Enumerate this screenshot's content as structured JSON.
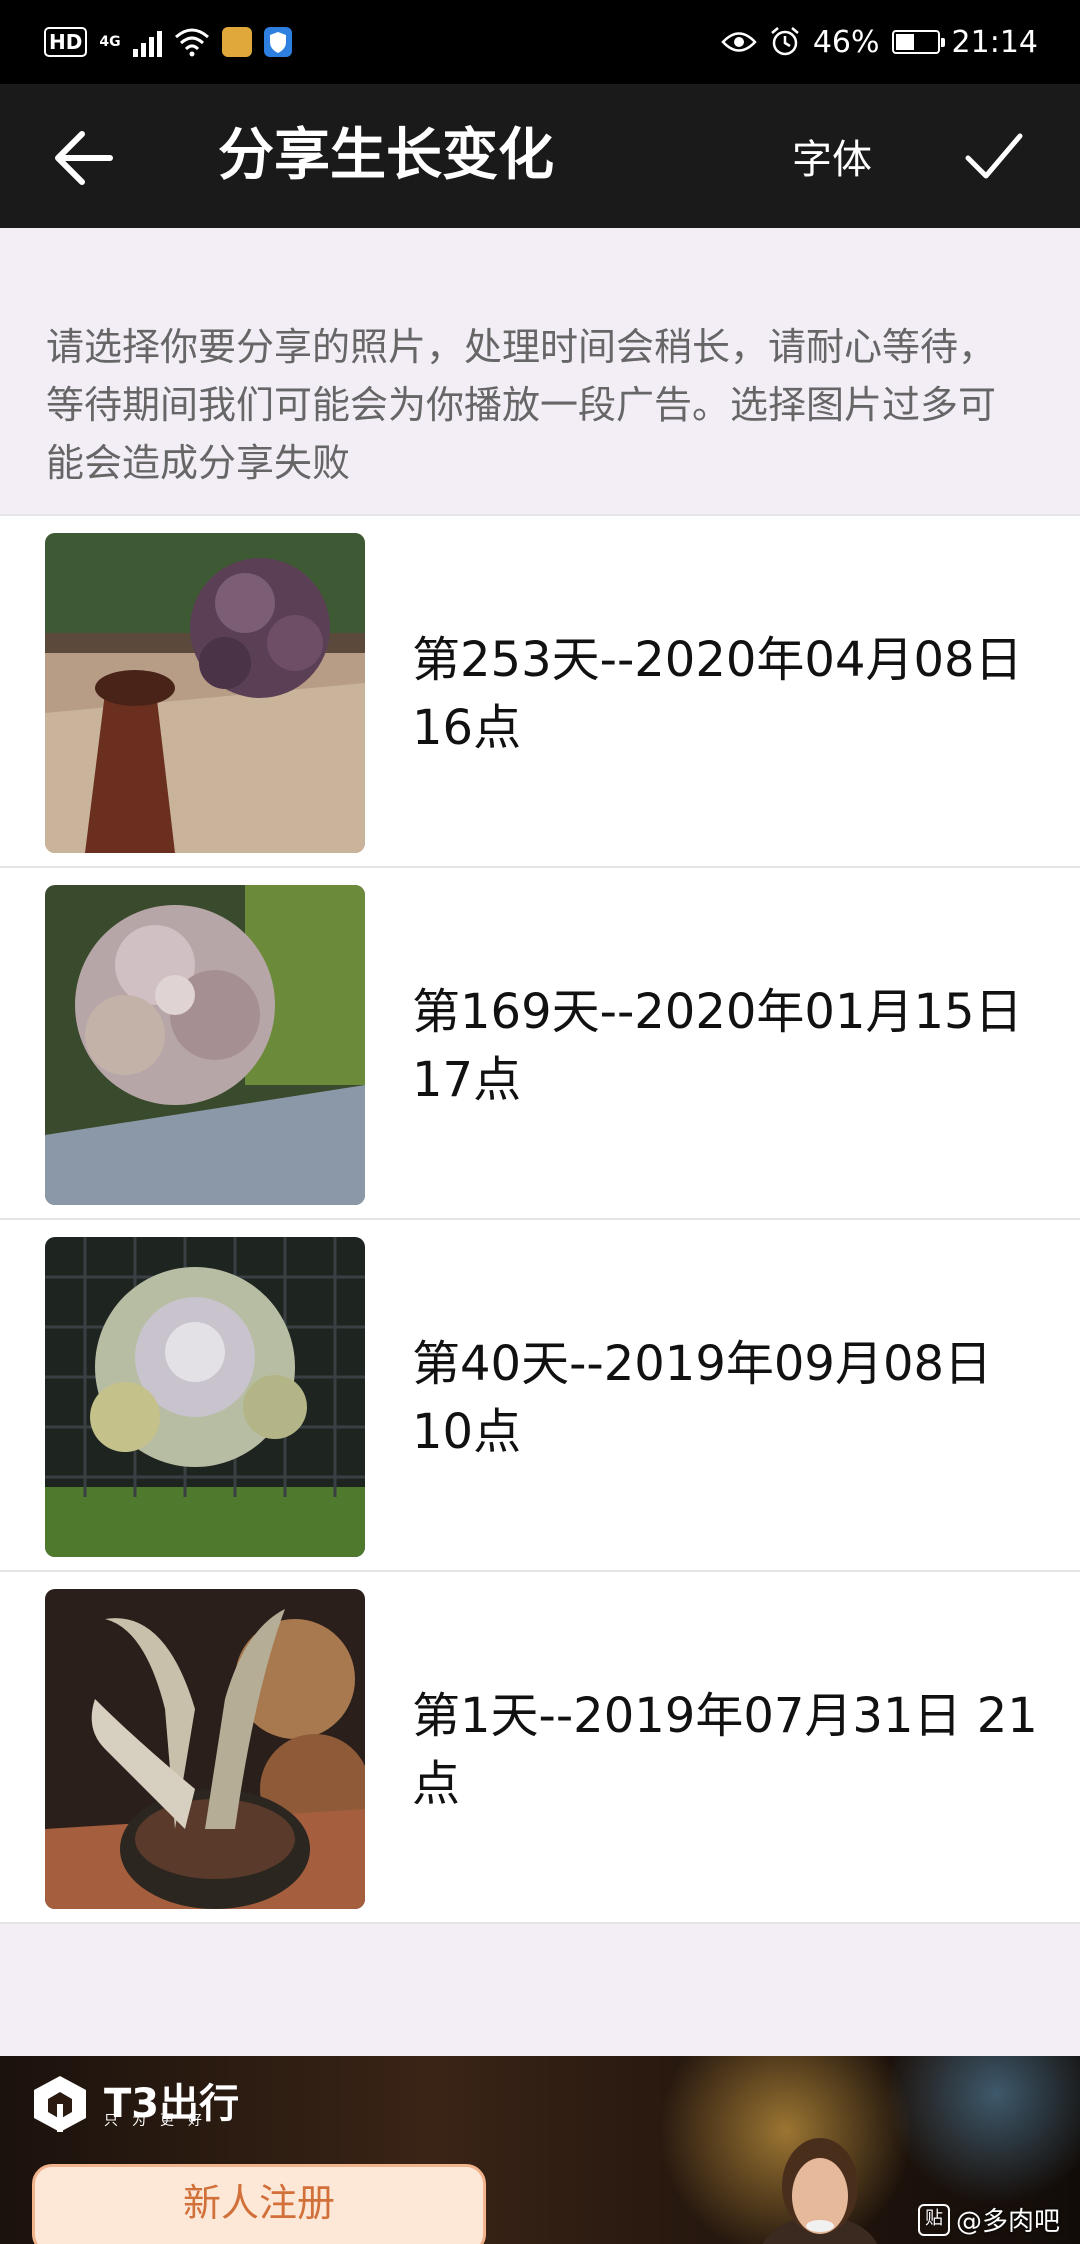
{
  "status_bar": {
    "hd_label": "HD",
    "network_label": "4G",
    "battery_percent": "46%",
    "battery_level": 0.46,
    "time": "21:14"
  },
  "header": {
    "title": "分享生长变化",
    "font_label": "字体"
  },
  "notice": {
    "text": "请选择你要分享的照片，处理时间会稍长，请耐心等待，等待期间我们可能会为你播放一段广告。选择图片过多可能会造成分享失败"
  },
  "photos": [
    {
      "caption": "第253天--2020年04月08日 16点"
    },
    {
      "caption": "第169天--2020年01月15日 17点"
    },
    {
      "caption": "第40天--2019年09月08日 10点"
    },
    {
      "caption": "第1天--2019年07月31日 21点"
    }
  ],
  "ad": {
    "logo_text": "T3出行",
    "slogan": "只为更好",
    "register_label": "新人注册",
    "watermark": "@多肉吧",
    "watermark_badge": "贴"
  },
  "colors": {
    "header_bg": "#1a1a1a",
    "page_bg": "#f3eef6",
    "register_text": "#d2703a"
  }
}
